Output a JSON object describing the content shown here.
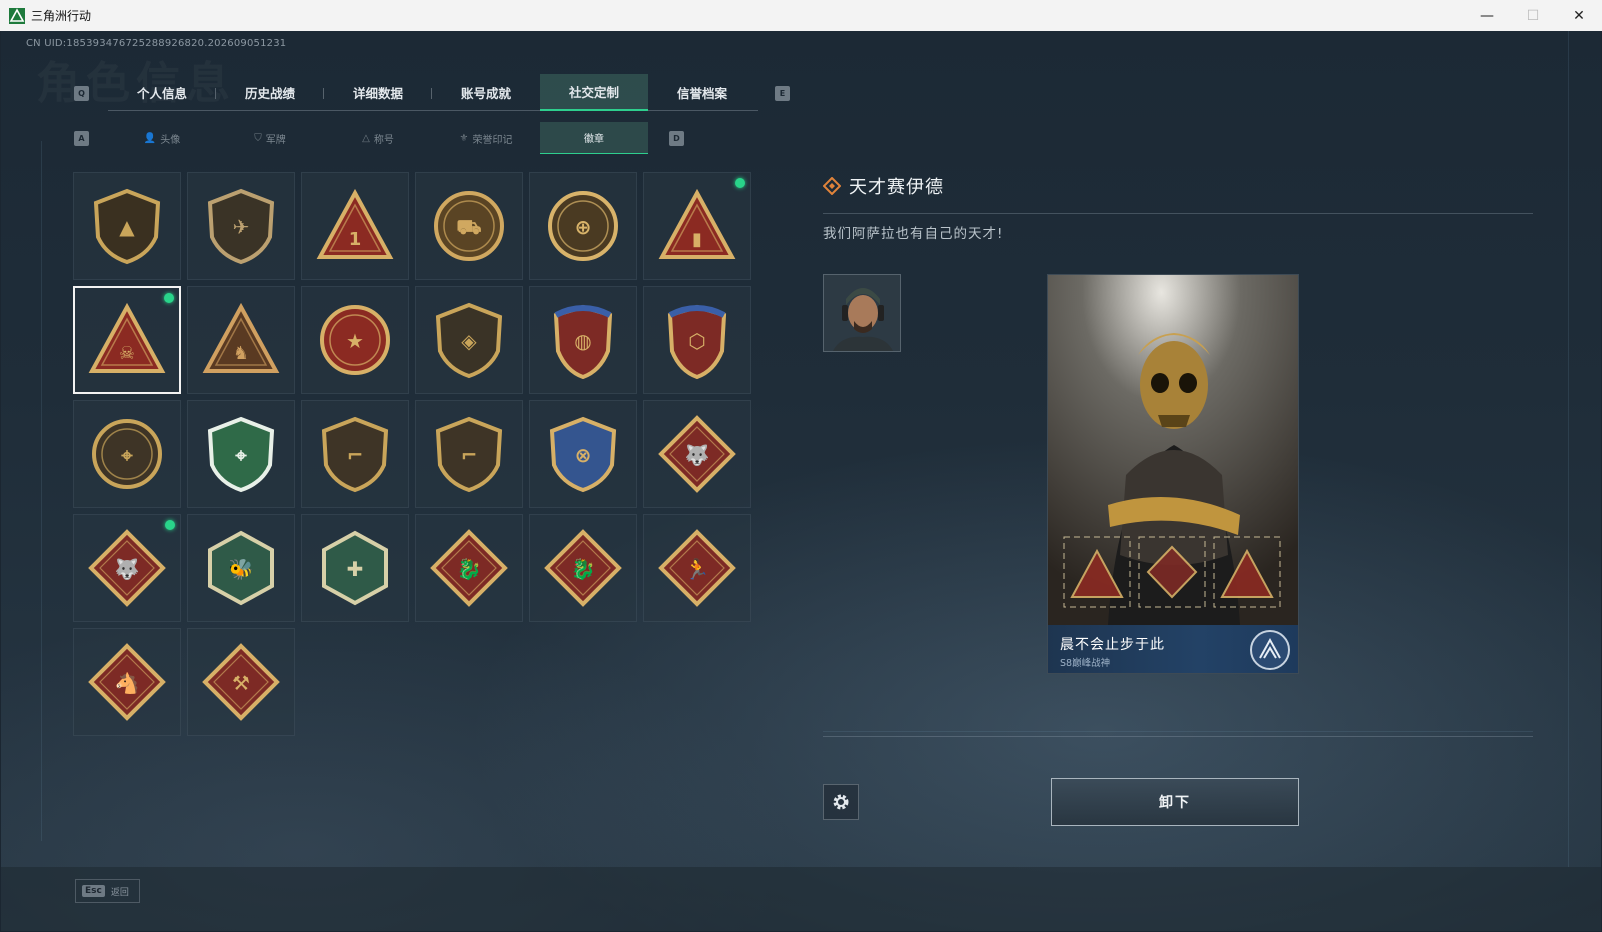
{
  "window": {
    "title": "三角洲行动",
    "controls": {
      "minimize": "—",
      "maximize": "☐",
      "close": "✕"
    }
  },
  "header": {
    "uid": "CN UID:185393476725288926820.202609051231",
    "watermark": "角色信息"
  },
  "main_tabs": {
    "left_key": "Q",
    "right_key": "E",
    "items": [
      {
        "label": "个人信息",
        "active": false
      },
      {
        "label": "历史战绩",
        "active": false
      },
      {
        "label": "详细数据",
        "active": false
      },
      {
        "label": "账号成就",
        "active": false
      },
      {
        "label": "社交定制",
        "active": true
      },
      {
        "label": "信誉档案",
        "active": false
      }
    ]
  },
  "sub_tabs": {
    "left_key": "A",
    "right_key": "D",
    "items": [
      {
        "label": "头像",
        "icon": "person-icon",
        "glyph": "👤",
        "active": false
      },
      {
        "label": "军牌",
        "icon": "dogtag-icon",
        "glyph": "⛉",
        "active": false
      },
      {
        "label": "称号",
        "icon": "title-icon",
        "glyph": "△",
        "active": false
      },
      {
        "label": "荣誉印记",
        "icon": "honor-icon",
        "glyph": "⚜",
        "active": false
      },
      {
        "label": "徽章",
        "icon": "badge-icon",
        "glyph": "",
        "active": true
      }
    ]
  },
  "badges": [
    {
      "name": "badge-delta-shield",
      "shape": "shield",
      "color": "#3a3020",
      "accent": "#c9a55a",
      "mark": "▲",
      "new": false,
      "selected": false
    },
    {
      "name": "badge-helicopter",
      "shape": "shield",
      "color": "#3a3326",
      "accent": "#bba070",
      "mark": "✈",
      "new": false,
      "selected": false
    },
    {
      "name": "badge-rank-one",
      "shape": "triangle",
      "color": "#8b2a22",
      "accent": "#d7b067",
      "mark": "1",
      "new": false,
      "selected": false
    },
    {
      "name": "badge-delta-force-tank",
      "shape": "round",
      "color": "#5a4424",
      "accent": "#d0a860",
      "mark": "⛟",
      "new": false,
      "selected": false
    },
    {
      "name": "badge-delta-force-2026",
      "shape": "round",
      "color": "#4a3a22",
      "accent": "#d8b36a",
      "mark": "⊕",
      "new": false,
      "selected": false
    },
    {
      "name": "badge-red-triangle-flag",
      "shape": "triangle",
      "color": "#8b2a22",
      "accent": "#d7b067",
      "mark": "▮",
      "new": true,
      "selected": false
    },
    {
      "name": "badge-red-triangle-skull",
      "shape": "triangle",
      "color": "#8b2a22",
      "accent": "#d7b067",
      "mark": "☠",
      "new": true,
      "selected": true
    },
    {
      "name": "badge-squad-triangle",
      "shape": "triangle",
      "color": "#5a3a22",
      "accent": "#d0a060",
      "mark": "♞",
      "new": false,
      "selected": false
    },
    {
      "name": "badge-star-medal",
      "shape": "round",
      "color": "#8b2a22",
      "accent": "#d7b067",
      "mark": "★",
      "new": false,
      "selected": false
    },
    {
      "name": "badge-hawk-shield",
      "shape": "shield",
      "color": "#3a3326",
      "accent": "#c9a55a",
      "mark": "◈",
      "new": false,
      "selected": false
    },
    {
      "name": "badge-crest-gold",
      "shape": "crest",
      "color": "#7d2a25",
      "accent": "#d7b067",
      "mark": "◍",
      "new": false,
      "selected": false
    },
    {
      "name": "badge-crest-hex",
      "shape": "crest",
      "color": "#7d2a25",
      "accent": "#d7b067",
      "mark": "⬡",
      "new": false,
      "selected": false
    },
    {
      "name": "badge-crosshair-soldier",
      "shape": "round",
      "color": "#3e3426",
      "accent": "#c9a55a",
      "mark": "⌖",
      "new": false,
      "selected": false
    },
    {
      "name": "badge-green-rifle",
      "shape": "shield",
      "color": "#2f6a48",
      "accent": "#e8f0e8",
      "mark": "⌖",
      "new": false,
      "selected": false
    },
    {
      "name": "badge-rifle-shield-1",
      "shape": "shield",
      "color": "#3e3426",
      "accent": "#c9a55a",
      "mark": "⌐",
      "new": false,
      "selected": false
    },
    {
      "name": "badge-rifle-shield-2",
      "shape": "shield",
      "color": "#3e3426",
      "accent": "#c9a55a",
      "mark": "⌐",
      "new": false,
      "selected": false
    },
    {
      "name": "badge-blue-gold-shield",
      "shape": "shield",
      "color": "#34558f",
      "accent": "#d7b067",
      "mark": "⊗",
      "new": false,
      "selected": false
    },
    {
      "name": "badge-wolf-red",
      "shape": "diamond",
      "color": "#7d2a25",
      "accent": "#d7b067",
      "mark": "🐺",
      "new": false,
      "selected": false
    },
    {
      "name": "badge-wolf-red-2",
      "shape": "diamond",
      "color": "#7d2a25",
      "accent": "#d7b067",
      "mark": "🐺",
      "new": true,
      "selected": false
    },
    {
      "name": "badge-hornet-hex",
      "shape": "hexagon",
      "color": "#2f5a48",
      "accent": "#d7d0a8",
      "mark": "🐝",
      "new": false,
      "selected": false
    },
    {
      "name": "badge-medic-hex",
      "shape": "hexagon",
      "color": "#2f5a48",
      "accent": "#d7d0a8",
      "mark": "✚",
      "new": false,
      "selected": false
    },
    {
      "name": "badge-dragon-red",
      "shape": "diamond",
      "color": "#7d2a25",
      "accent": "#d7b067",
      "mark": "🐉",
      "new": false,
      "selected": false
    },
    {
      "name": "badge-dragon-red-2",
      "shape": "diamond",
      "color": "#7d2a25",
      "accent": "#d7b067",
      "mark": "🐉",
      "new": false,
      "selected": false
    },
    {
      "name": "badge-runner-red",
      "shape": "diamond",
      "color": "#7d2a25",
      "accent": "#d7b067",
      "mark": "🏃",
      "new": false,
      "selected": false
    },
    {
      "name": "badge-horse-red",
      "shape": "diamond",
      "color": "#7d2a25",
      "accent": "#d7b067",
      "mark": "🐴",
      "new": false,
      "selected": false
    },
    {
      "name": "badge-tools-red",
      "shape": "diamond",
      "color": "#7d2a25",
      "accent": "#d7b067",
      "mark": "⚒",
      "new": false,
      "selected": false
    }
  ],
  "detail": {
    "title": "天才赛伊德",
    "description": "我们阿萨拉也有自己的天才!",
    "card": {
      "name": "晨不会止步于此",
      "subtitle": "S8巅峰战神"
    },
    "unequip_label": "卸下"
  },
  "footer": {
    "esc_key": "Esc",
    "esc_label": "返回"
  },
  "colors": {
    "accent_green": "#2ecf8e",
    "new_dot": "#29d48a"
  }
}
